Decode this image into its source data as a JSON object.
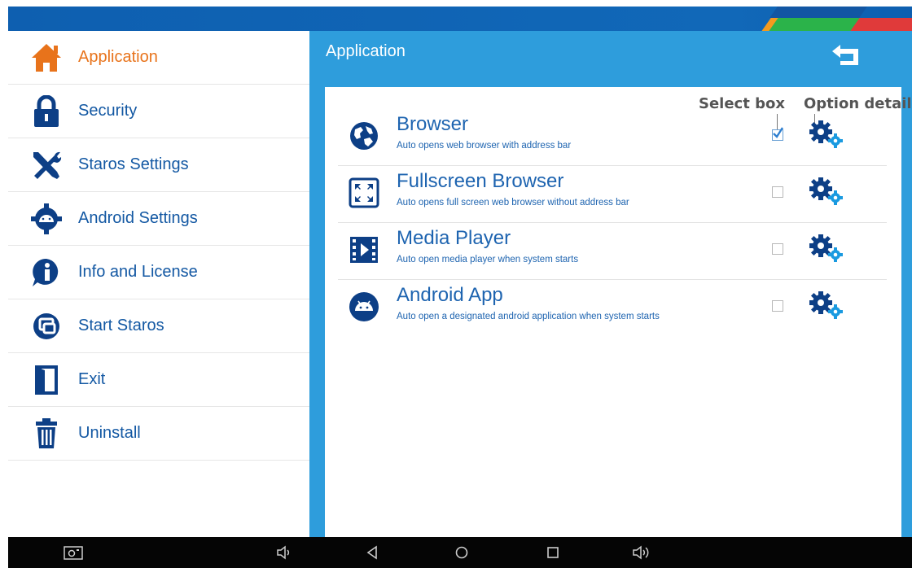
{
  "sidebar": {
    "items": [
      {
        "label": "Application",
        "icon": "home-icon"
      },
      {
        "label": "Security",
        "icon": "lock-icon"
      },
      {
        "label": "Staros Settings",
        "icon": "tools-icon"
      },
      {
        "label": "Android Settings",
        "icon": "android-gear-icon"
      },
      {
        "label": "Info and License",
        "icon": "info-icon"
      },
      {
        "label": "Start Staros",
        "icon": "start-icon"
      },
      {
        "label": "Exit",
        "icon": "exit-door-icon"
      },
      {
        "label": "Uninstall",
        "icon": "trash-icon"
      }
    ],
    "active_index": 0
  },
  "panel": {
    "title": "Application",
    "back_icon": "back-arrow-icon"
  },
  "annotations": {
    "select_box": "Select box",
    "option_detail": "Option detail"
  },
  "apps": [
    {
      "name": "Browser",
      "description": "Auto opens web browser with address bar",
      "checked": true,
      "icon": "globe-icon"
    },
    {
      "name": "Fullscreen Browser",
      "description": "Auto opens full screen web browser without address bar",
      "checked": false,
      "icon": "fullscreen-icon"
    },
    {
      "name": "Media Player",
      "description": "Auto open media player when system starts",
      "checked": false,
      "icon": "film-icon"
    },
    {
      "name": "Android App",
      "description": "Auto open a designated android application when system starts",
      "checked": false,
      "icon": "android-icon"
    }
  ],
  "navbar": {
    "buttons": [
      "screenshot-icon",
      "volume-down-icon",
      "back-triangle-icon",
      "home-circle-icon",
      "recents-square-icon",
      "volume-up-icon"
    ]
  },
  "colors": {
    "accent_blue": "#2e9ddc",
    "top_bar": "#0e5fb0",
    "active_orange": "#e8731b",
    "label_blue": "#1358a3",
    "gear_blue": "#0d3f86",
    "gear_light": "#1a9ae0"
  }
}
